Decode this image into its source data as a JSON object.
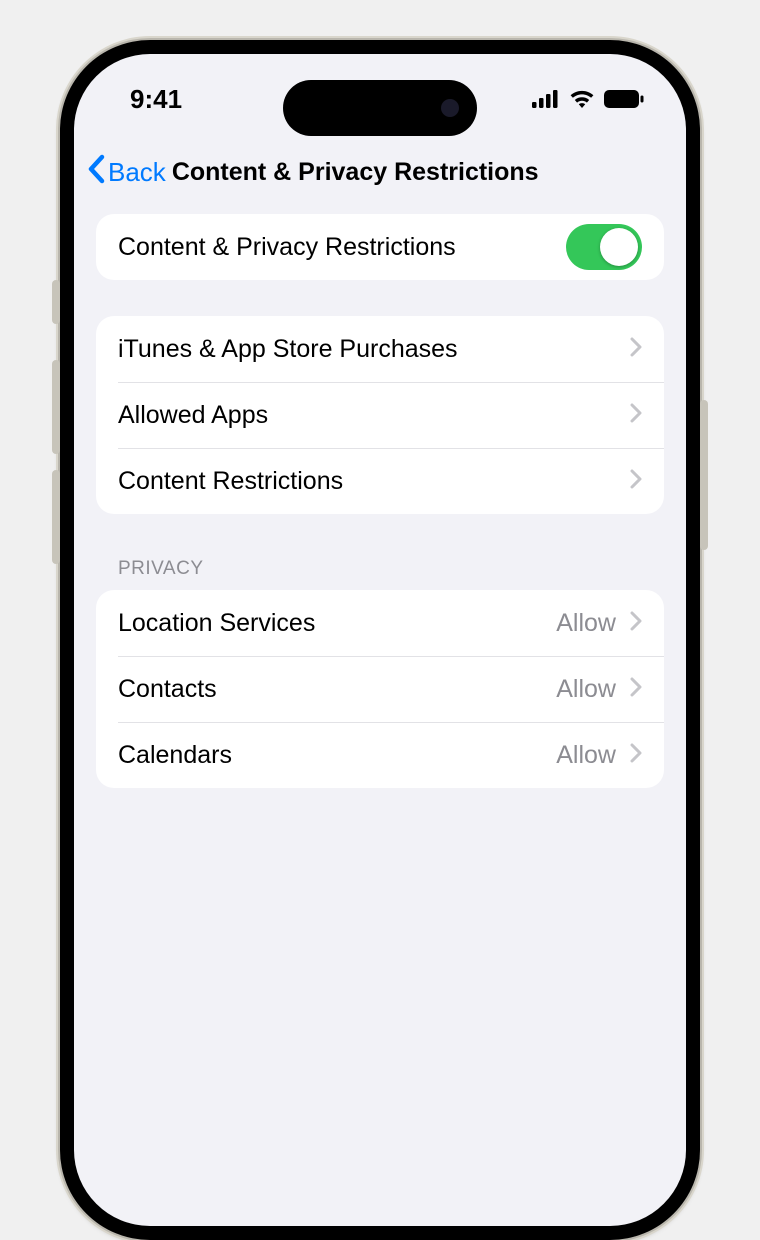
{
  "status": {
    "time": "9:41"
  },
  "nav": {
    "back_label": "Back",
    "title": "Content & Privacy Restrictions"
  },
  "toggle": {
    "label": "Content & Privacy Restrictions",
    "on": true
  },
  "main_group": [
    {
      "label": "iTunes & App Store Purchases"
    },
    {
      "label": "Allowed Apps"
    },
    {
      "label": "Content Restrictions"
    }
  ],
  "privacy_header": "PRIVACY",
  "privacy_group": [
    {
      "label": "Location Services",
      "value": "Allow"
    },
    {
      "label": "Contacts",
      "value": "Allow"
    },
    {
      "label": "Calendars",
      "value": "Allow"
    }
  ]
}
